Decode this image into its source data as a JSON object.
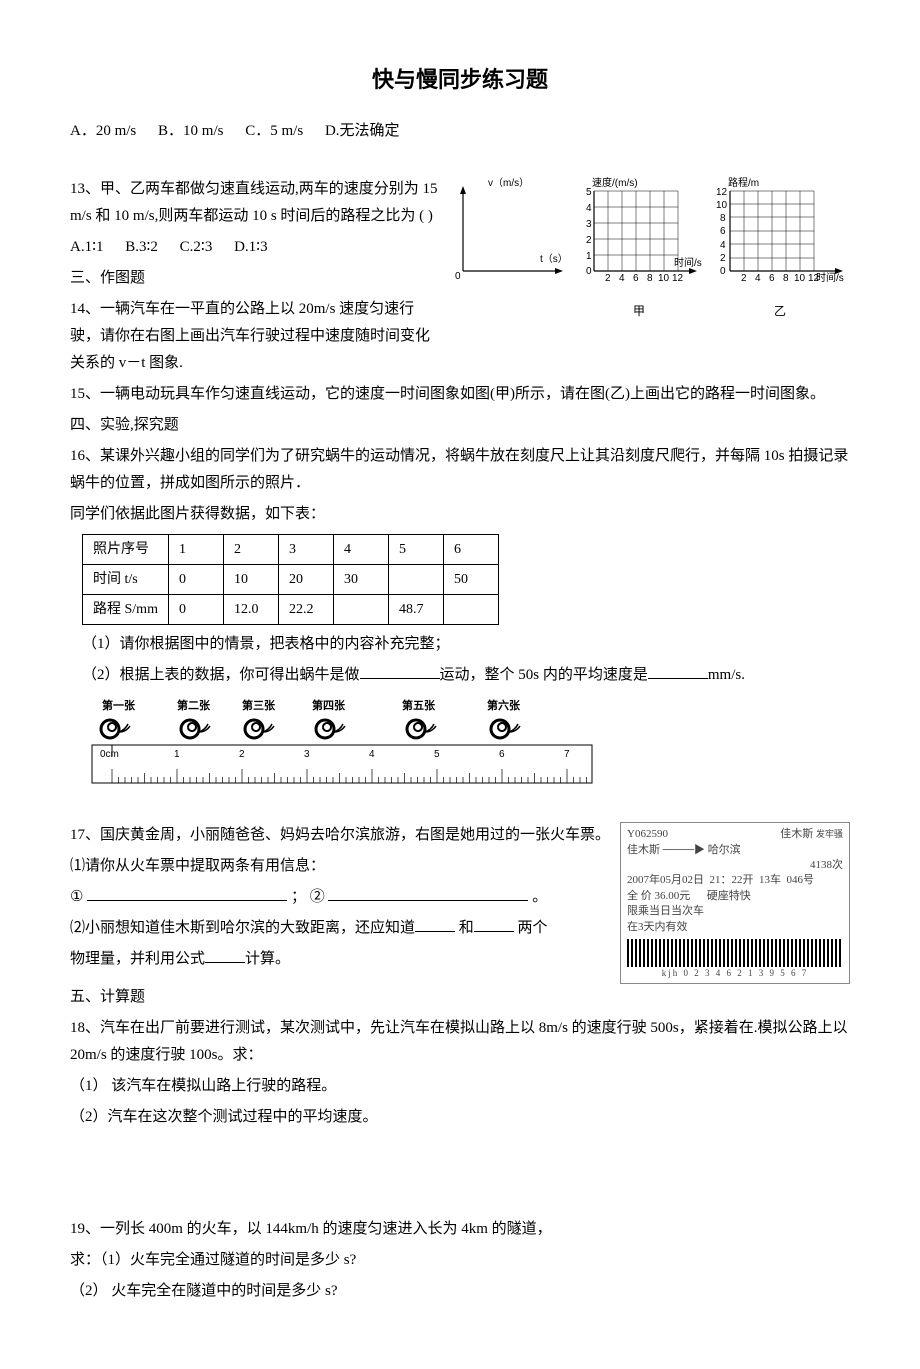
{
  "title": "快与慢同步练习题",
  "q12_options": {
    "a_prefix": "A．",
    "a": "20 m/s",
    "b_prefix": "B．",
    "b": "10 m/s",
    "c_prefix": "C．",
    "c": "5 m/s",
    "d_prefix": "D.",
    "d": "无法确定"
  },
  "q13": {
    "text": "13、甲、乙两车都做匀速直线运动,两车的速度分别为 15 m/s 和 10 m/s,则两车都运动 10 s 时间后的路程之比为 (        )",
    "opts": {
      "a": "A.1∶1",
      "b": "B.3∶2",
      "c": "C.2∶3",
      "d": "D.1∶3"
    }
  },
  "sec3": "三、作图题",
  "q14": {
    "text": "14、一辆汽车在一平直的公路上以 20m/s 速度匀速行驶，请你在右图上画出汽车行驶过程中速度随时间变化关系的 v－t 图象."
  },
  "q15": "15、一辆电动玩具车作匀速直线运动，它的速度一时间图象如图(甲)所示，请在图(乙)上画出它的路程一时间图象。",
  "sec4": "四、实验,探究题",
  "q16": {
    "p1": "16、某课外兴趣小组的同学们为了研究蜗牛的运动情况，将蜗牛放在刻度尺上让其沿刻度尺爬行，并每隔 10s 拍摄记录蜗牛的位置，拼成如图所示的照片．",
    "p2": "同学们依据此图片获得数据，如下表：",
    "sub1": "（1）请你根据图中的情景，把表格中的内容补充完整；",
    "sub2_a": "（2）根据上表的数据，你可得出蜗牛是做",
    "sub2_b": "运动，整个 50s 内的平均速度是",
    "sub2_c": "mm/s."
  },
  "table": {
    "headers": [
      "照片序号",
      "1",
      "2",
      "3",
      "4",
      "5",
      "6"
    ],
    "row_time": [
      "时间 t/s",
      "0",
      "10",
      "20",
      "30",
      "",
      "50"
    ],
    "row_dist": [
      "路程 S/mm",
      "0",
      "12.0",
      "22.2",
      "",
      "48.7",
      ""
    ]
  },
  "ruler": {
    "labels": [
      "第一张",
      "第二张",
      "第三张",
      "第四张",
      "第五张",
      "第六张"
    ],
    "zero": "0cm",
    "ticks": [
      "1",
      "2",
      "3",
      "4",
      "5",
      "6",
      "7"
    ]
  },
  "q17": {
    "p1": "17、国庆黄金周，小丽随爸爸、妈妈去哈尔滨旅游，右图是她用过的一张火车票。",
    "p2": "⑴请你从火车票中提取两条有用信息：",
    "circ1": "①",
    "semi": "；",
    "circ2": "②",
    "period": "。",
    "p3a": "⑵小丽想知道佳木斯到哈尔滨的大致距离，还应知道",
    "p3b": "和",
    "p3c": "两个",
    "p3d": "物理量，并利用公式",
    "p3e": "计算。"
  },
  "ticket": {
    "code": "Y062590",
    "from_to_a": "佳木斯",
    "arrow": "────▶",
    "from_to_b": "哈尔滨",
    "corner": "佳木斯",
    "stamp": "发牢骚",
    "train": "4138次",
    "line3a": "2007年05月02日",
    "line3b": "21：22开",
    "line3c": "13车",
    "line3d": "046号",
    "line4a": "全    价 36.00元",
    "line4b": "硬座特快",
    "line5": "限乘当日当次车",
    "line6": "在3天内有效",
    "barcode_sub": "kjh 0 2 3 4 6 2 1 3 9 5 6 7"
  },
  "sec5": "五、计算题",
  "q18": {
    "p1": "18、汽车在出厂前要进行测试，某次测试中，先让汽车在模拟山路上以 8m/s 的速度行驶 500s，紧接着在.模拟公路上以 20m/s 的速度行驶 100s。求：",
    "s1": "（1）  该汽车在模拟山路上行驶的路程。",
    "s2": "（2）汽车在这次整个测试过程中的平均速度。"
  },
  "q19": {
    "p1": "19、一列长 400m 的火车，以 144km/h 的速度匀速进入长为 4km 的隧道，",
    "s1": "求：（1）火车完全通过隧道的时间是多少 s?",
    "s2": "（2） 火车完全在隧道中的时间是多少 s?"
  },
  "chart_data": [
    {
      "type": "line",
      "name": "q14-vt-blank",
      "title": "",
      "xlabel": "t (s)",
      "ylabel": "v（m/s）",
      "xlim": [
        0,
        10
      ],
      "ylim": [
        0,
        30
      ],
      "series": []
    },
    {
      "type": "line",
      "name": "q15-甲-vt",
      "title": "甲",
      "xlabel": "时间/s",
      "ylabel": "速度/(m/s)",
      "xlim": [
        0,
        12
      ],
      "ylim": [
        0,
        5
      ],
      "xticks": [
        0,
        2,
        4,
        6,
        8,
        10,
        12
      ],
      "yticks": [
        0,
        1,
        2,
        3,
        4,
        5
      ],
      "series": []
    },
    {
      "type": "line",
      "name": "q15-乙-st",
      "title": "乙",
      "xlabel": "时间/s",
      "ylabel": "路程/m",
      "xlim": [
        0,
        12
      ],
      "ylim": [
        0,
        12
      ],
      "xticks": [
        0,
        2,
        4,
        6,
        8,
        10,
        12
      ],
      "yticks": [
        0,
        2,
        4,
        6,
        8,
        10,
        12
      ],
      "series": []
    }
  ]
}
